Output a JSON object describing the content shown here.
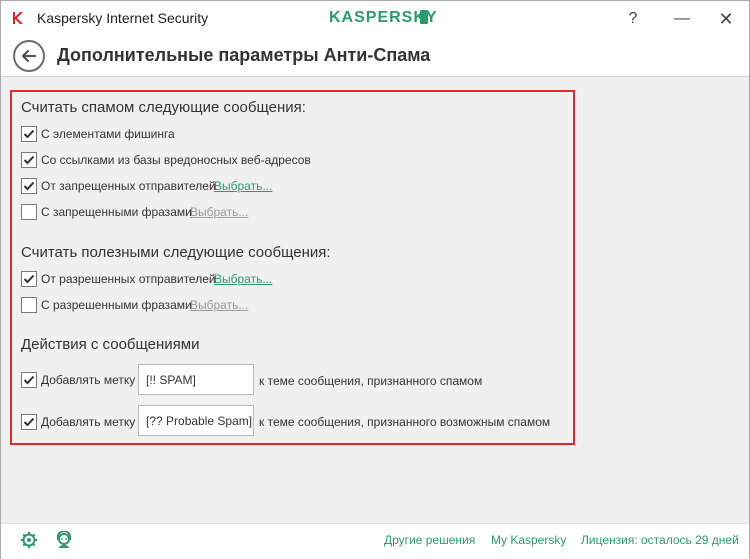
{
  "window": {
    "app_title": "Kaspersky Internet Security",
    "brand": "KASPERSKY",
    "help_btn": "?",
    "minimize_btn": "—",
    "close_btn": "✕"
  },
  "header": {
    "title": "Дополнительные параметры Анти-Спама"
  },
  "spam_section": {
    "title": "Считать спамом следующие сообщения:",
    "items": [
      {
        "label": "С элементами фишинга",
        "checked": true
      },
      {
        "label": "Со ссылками из базы вредоносных веб-адресов",
        "checked": true
      },
      {
        "label": "От запрещенных отправителей",
        "checked": true,
        "link": "Выбрать...",
        "link_enabled": true
      },
      {
        "label": "С запрещенными фразами",
        "checked": false,
        "link": "Выбрать...",
        "link_enabled": false
      }
    ]
  },
  "useful_section": {
    "title": "Считать полезными следующие сообщения:",
    "items": [
      {
        "label": "От разрешенных отправителей",
        "checked": true,
        "link": "Выбрать...",
        "link_enabled": true
      },
      {
        "label": "С разрешенными фразами",
        "checked": false,
        "link": "Выбрать...",
        "link_enabled": false
      }
    ]
  },
  "actions_section": {
    "title": "Действия с сообщениями",
    "items": [
      {
        "label": "Добавлять метку",
        "checked": true,
        "value": "[!! SPAM]",
        "suffix": "к теме сообщения, признанного спамом"
      },
      {
        "label": "Добавлять метку",
        "checked": true,
        "value": "[?? Probable Spam]",
        "suffix": "к теме сообщения, признанного возможным спамом"
      }
    ]
  },
  "footer": {
    "other_solutions": "Другие решения",
    "my_kaspersky": "My Kaspersky",
    "license": "Лицензия: осталось 29 дней"
  },
  "colors": {
    "accent": "#2d9a6e",
    "highlight_border": "#e02b2b",
    "content_bg": "#f0f0f0"
  }
}
